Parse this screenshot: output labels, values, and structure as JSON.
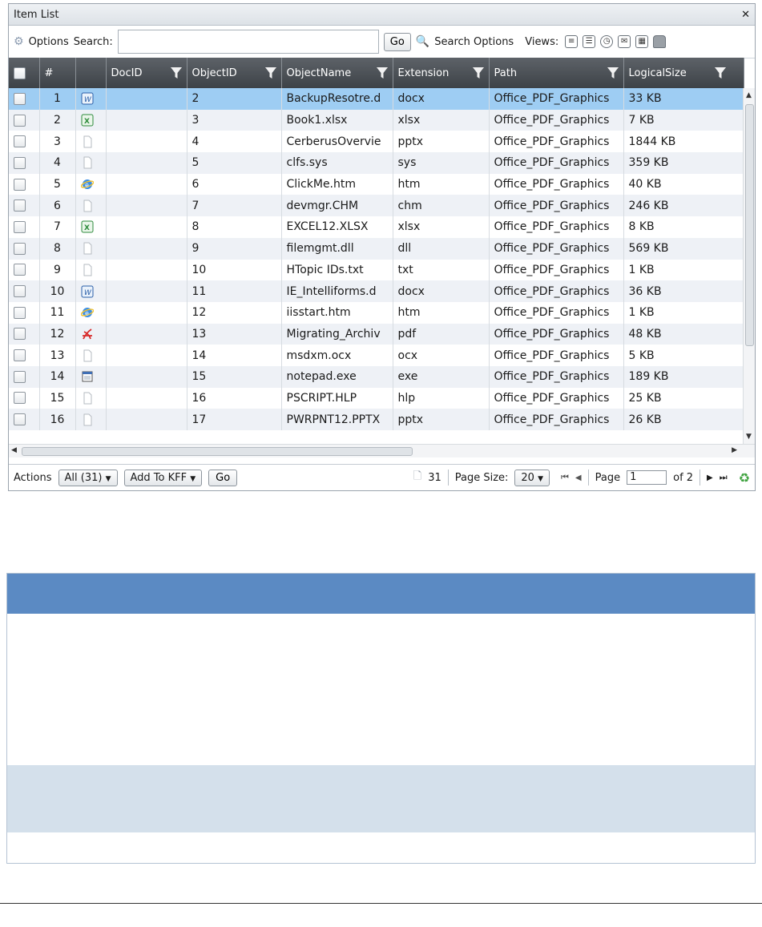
{
  "title": "Item List",
  "title_controls": {
    "pin": "1",
    "close": "✕"
  },
  "toolbar": {
    "options_label": "Options",
    "search_label": "Search:",
    "search_value": "",
    "go_label": "Go",
    "search_options_label": "Search Options",
    "views_label": "Views:"
  },
  "columns": [
    "#",
    "DocID",
    "ObjectID",
    "ObjectName",
    "Extension",
    "Path",
    "LogicalSize"
  ],
  "rows": [
    {
      "n": "1",
      "icon": "word-icon",
      "docid": "",
      "objectid": "2",
      "name": "BackupResotre.d",
      "ext": "docx",
      "path": "Office_PDF_Graphics",
      "size": "33 KB"
    },
    {
      "n": "2",
      "icon": "excel-icon",
      "docid": "",
      "objectid": "3",
      "name": "Book1.xlsx",
      "ext": "xlsx",
      "path": "Office_PDF_Graphics",
      "size": "7 KB"
    },
    {
      "n": "3",
      "icon": "file-icon",
      "docid": "",
      "objectid": "4",
      "name": "CerberusOvervie",
      "ext": "pptx",
      "path": "Office_PDF_Graphics",
      "size": "1844 KB"
    },
    {
      "n": "4",
      "icon": "file-icon",
      "docid": "",
      "objectid": "5",
      "name": "clfs.sys",
      "ext": "sys",
      "path": "Office_PDF_Graphics",
      "size": "359 KB"
    },
    {
      "n": "5",
      "icon": "ie-icon",
      "docid": "",
      "objectid": "6",
      "name": "ClickMe.htm",
      "ext": "htm",
      "path": "Office_PDF_Graphics",
      "size": "40 KB"
    },
    {
      "n": "6",
      "icon": "file-icon",
      "docid": "",
      "objectid": "7",
      "name": "devmgr.CHM",
      "ext": "chm",
      "path": "Office_PDF_Graphics",
      "size": "246 KB"
    },
    {
      "n": "7",
      "icon": "excel-icon",
      "docid": "",
      "objectid": "8",
      "name": "EXCEL12.XLSX",
      "ext": "xlsx",
      "path": "Office_PDF_Graphics",
      "size": "8 KB"
    },
    {
      "n": "8",
      "icon": "file-icon",
      "docid": "",
      "objectid": "9",
      "name": "filemgmt.dll",
      "ext": "dll",
      "path": "Office_PDF_Graphics",
      "size": "569 KB"
    },
    {
      "n": "9",
      "icon": "file-icon",
      "docid": "",
      "objectid": "10",
      "name": "HTopic IDs.txt",
      "ext": "txt",
      "path": "Office_PDF_Graphics",
      "size": "1 KB"
    },
    {
      "n": "10",
      "icon": "word-icon",
      "docid": "",
      "objectid": "11",
      "name": "IE_Intelliforms.d",
      "ext": "docx",
      "path": "Office_PDF_Graphics",
      "size": "36 KB"
    },
    {
      "n": "11",
      "icon": "ie-icon",
      "docid": "",
      "objectid": "12",
      "name": "iisstart.htm",
      "ext": "htm",
      "path": "Office_PDF_Graphics",
      "size": "1 KB"
    },
    {
      "n": "12",
      "icon": "pdf-icon",
      "docid": "",
      "objectid": "13",
      "name": "Migrating_Archiv",
      "ext": "pdf",
      "path": "Office_PDF_Graphics",
      "size": "48 KB"
    },
    {
      "n": "13",
      "icon": "file-icon",
      "docid": "",
      "objectid": "14",
      "name": "msdxm.ocx",
      "ext": "ocx",
      "path": "Office_PDF_Graphics",
      "size": "5 KB"
    },
    {
      "n": "14",
      "icon": "exe-icon",
      "docid": "",
      "objectid": "15",
      "name": "notepad.exe",
      "ext": "exe",
      "path": "Office_PDF_Graphics",
      "size": "189 KB"
    },
    {
      "n": "15",
      "icon": "file-icon",
      "docid": "",
      "objectid": "16",
      "name": "PSCRIPT.HLP",
      "ext": "hlp",
      "path": "Office_PDF_Graphics",
      "size": "25 KB"
    },
    {
      "n": "16",
      "icon": "file-icon",
      "docid": "",
      "objectid": "17",
      "name": "PWRPNT12.PPTX",
      "ext": "pptx",
      "path": "Office_PDF_Graphics",
      "size": "26 KB"
    }
  ],
  "selected_row": "1",
  "footer": {
    "actions_label": "Actions",
    "scope_select": "All (31)",
    "action_select": "Add To KFF",
    "go_label": "Go",
    "item_count": "31",
    "page_size_label": "Page Size:",
    "page_size_value": "20",
    "page_label": "Page",
    "page_value": "1",
    "of_label": "of 2"
  },
  "colors": {
    "header": "#4a4f55",
    "selected": "#9ecdf3",
    "accent": "#5b8ac3",
    "band": "#d4e0eb"
  }
}
